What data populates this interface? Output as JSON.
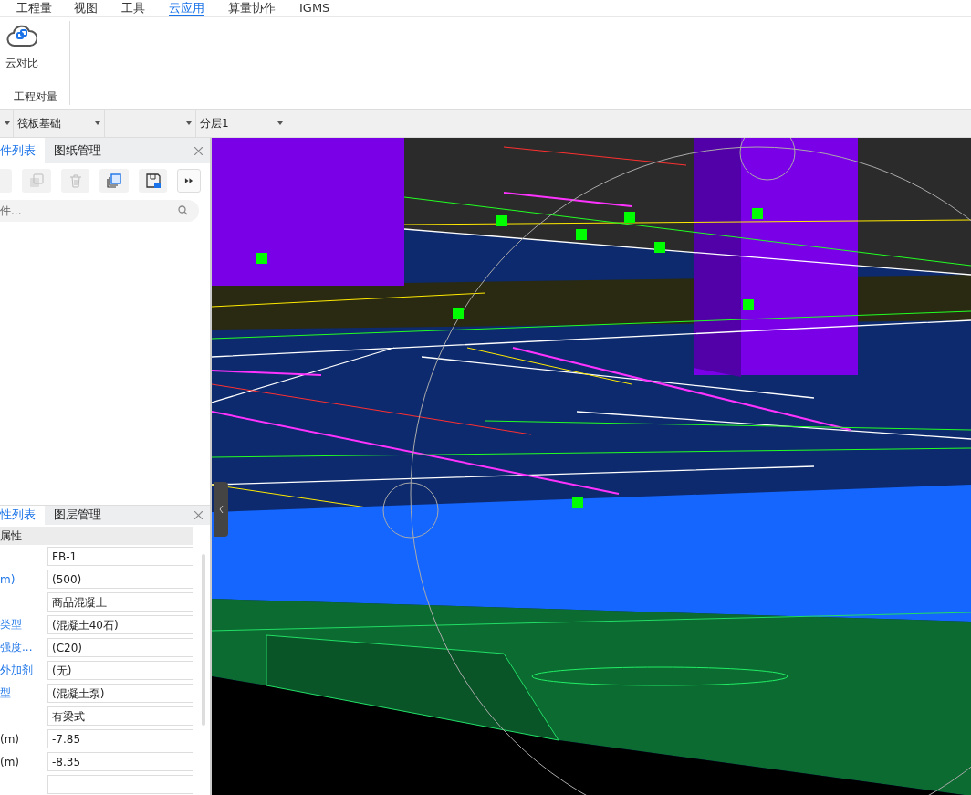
{
  "menu_tabs": [
    {
      "label": "工程量",
      "selected": false
    },
    {
      "label": "视图",
      "selected": false
    },
    {
      "label": "工具",
      "selected": false
    },
    {
      "label": "云应用",
      "selected": true
    },
    {
      "label": "算量协作",
      "selected": false
    },
    {
      "label": "IGMS",
      "selected": false
    }
  ],
  "ribbon": {
    "buttons": [
      {
        "label": "云对比"
      }
    ],
    "group_label": "工程对量"
  },
  "selector_bar": {
    "dropdowns": [
      {
        "kind": "narrow"
      },
      {
        "kind": "normal",
        "value": "筏板基础"
      },
      {
        "kind": "normal"
      },
      {
        "kind": "normal",
        "value": "分层1"
      }
    ]
  },
  "component_panel": {
    "tabs": [
      {
        "label": "件列表",
        "selected": true
      },
      {
        "label": "图纸管理",
        "selected": false
      }
    ],
    "toolbar": [
      {
        "kind": "new"
      },
      {
        "kind": "copy",
        "disabled": true
      },
      {
        "kind": "delete",
        "disabled": true
      },
      {
        "kind": "layer-copy",
        "disabled": false
      },
      {
        "kind": "save",
        "disabled": false
      },
      {
        "kind": "more",
        "disabled": false
      }
    ],
    "search": {
      "placeholder": "件..."
    }
  },
  "property_panel": {
    "tabs": [
      {
        "label": "性列表",
        "selected": true
      },
      {
        "label": "图层管理",
        "selected": false
      }
    ],
    "header": "属性",
    "rows": [
      {
        "value": "FB-1"
      },
      {
        "label": "m)",
        "value": "(500)",
        "link": true
      },
      {
        "value": "商品混凝土"
      },
      {
        "label": "类型",
        "value": "(混凝土40石)",
        "link": true
      },
      {
        "label": "强度...",
        "value": "(C20)",
        "link": true
      },
      {
        "label": "外加剂",
        "value": "(无)",
        "link": true
      },
      {
        "label": "型",
        "value": "(混凝土泵)",
        "link": true
      },
      {
        "value": "有梁式"
      },
      {
        "label": "(m)",
        "value": "-7.85",
        "link": false
      },
      {
        "label": "(m)",
        "value": "-8.35",
        "link": false
      },
      {}
    ]
  }
}
